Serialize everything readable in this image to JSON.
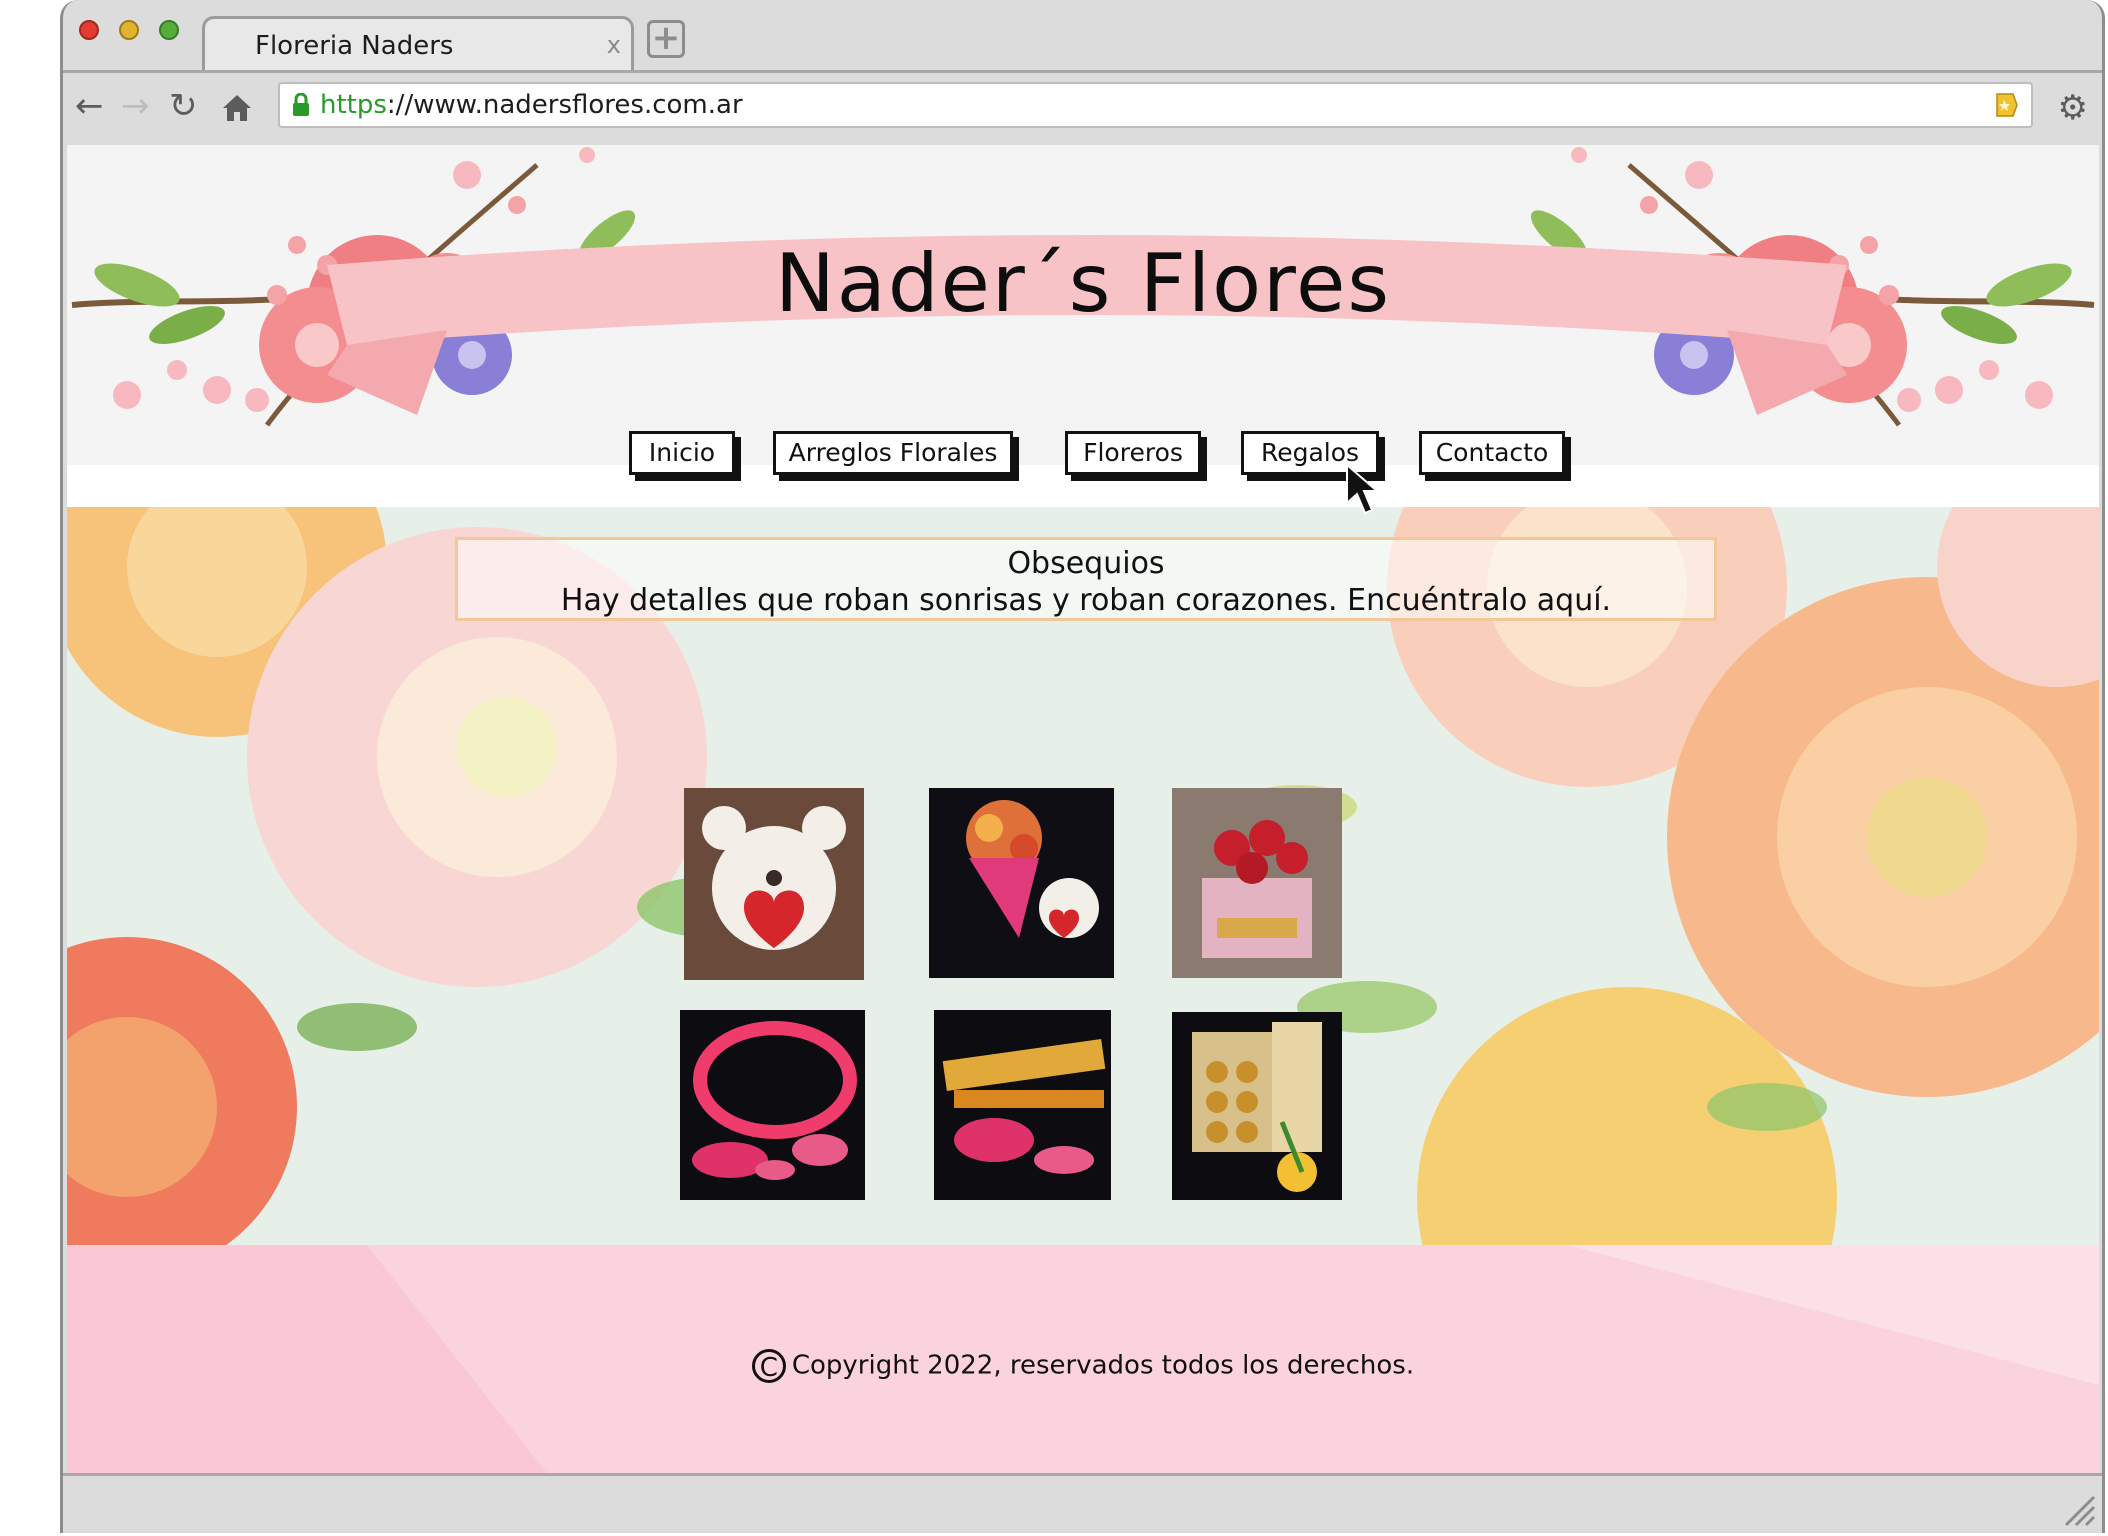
{
  "browser": {
    "tab_title": "Floreria Naders",
    "tab_close": "x",
    "new_tab": "+",
    "url_protocol": "https",
    "url_rest": "://www.nadersflores.com.ar"
  },
  "site": {
    "title": "Nader´s Flores"
  },
  "nav": {
    "items": [
      {
        "label": "Inicio"
      },
      {
        "label": "Arreglos Florales"
      },
      {
        "label": "Floreros"
      },
      {
        "label": "Regalos"
      },
      {
        "label": "Contacto"
      }
    ]
  },
  "section": {
    "title": "Obsequios",
    "subtitle": "Hay detalles que roban sonrisas y roban corazones. Encuéntralo aquí."
  },
  "footer": {
    "copyright_symbol": "C",
    "copyright_text": "Copyright 2022, reservados todos los derechos."
  },
  "colors": {
    "accent_pink": "#f7b9bf",
    "footer_bg": "#fbd6df",
    "url_protocol": "#2a9a2a"
  }
}
